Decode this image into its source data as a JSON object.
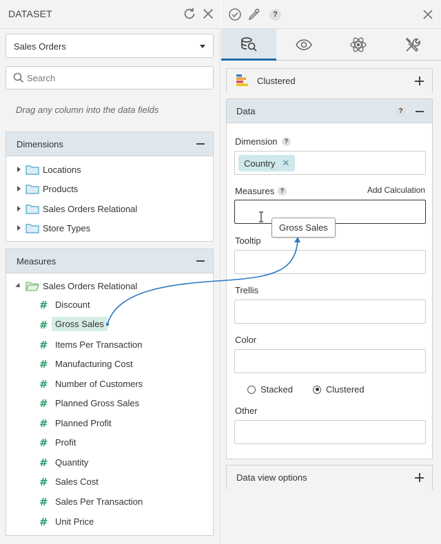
{
  "dataset": {
    "title": "DATASET",
    "source_value": "Sales Orders",
    "search_placeholder": "Search",
    "hint": "Drag any column into the data fields"
  },
  "dimensions": {
    "title": "Dimensions",
    "items": [
      {
        "label": "Locations"
      },
      {
        "label": "Products"
      },
      {
        "label": "Sales Orders Relational"
      },
      {
        "label": "Store Types"
      }
    ]
  },
  "measures": {
    "title": "Measures",
    "folder": "Sales Orders Relational",
    "items": [
      {
        "label": "Discount"
      },
      {
        "label": "Gross Sales"
      },
      {
        "label": "Items Per Transaction"
      },
      {
        "label": "Manufacturing Cost"
      },
      {
        "label": "Number of Customers"
      },
      {
        "label": "Planned Gross Sales"
      },
      {
        "label": "Planned Profit"
      },
      {
        "label": "Profit"
      },
      {
        "label": "Quantity"
      },
      {
        "label": "Sales Cost"
      },
      {
        "label": "Sales Per Transaction"
      },
      {
        "label": "Unit Price"
      }
    ]
  },
  "toolbar": {
    "help": "?"
  },
  "tabs": [
    {
      "icon": "data-search-icon",
      "active": true
    },
    {
      "icon": "eye-icon",
      "active": false
    },
    {
      "icon": "atom-icon",
      "active": false
    },
    {
      "icon": "tools-icon",
      "active": false
    }
  ],
  "chart_type": {
    "label": "Clustered",
    "icon": "clustered-bar-icon"
  },
  "data_section": {
    "title": "Data",
    "help": "?",
    "dimension_label": "Dimension",
    "dimension_chip": "Country",
    "measures_label": "Measures",
    "add_calculation": "Add Calculation",
    "tooltip_label": "Tooltip",
    "trellis_label": "Trellis",
    "color_label": "Color",
    "stacked_label": "Stacked",
    "clustered_label": "Clustered",
    "selected_mode": "Clustered",
    "other_label": "Other"
  },
  "data_view_options": {
    "label": "Data view options"
  },
  "drag": {
    "tooltip": "Gross Sales"
  },
  "colors": {
    "accent": "#1f6aa6",
    "measure_hash": "#2e9e6e",
    "header_bg": "#dfe7ed",
    "chip_bg": "#cfe8ec",
    "drag_highlight": "#d6ede3"
  }
}
